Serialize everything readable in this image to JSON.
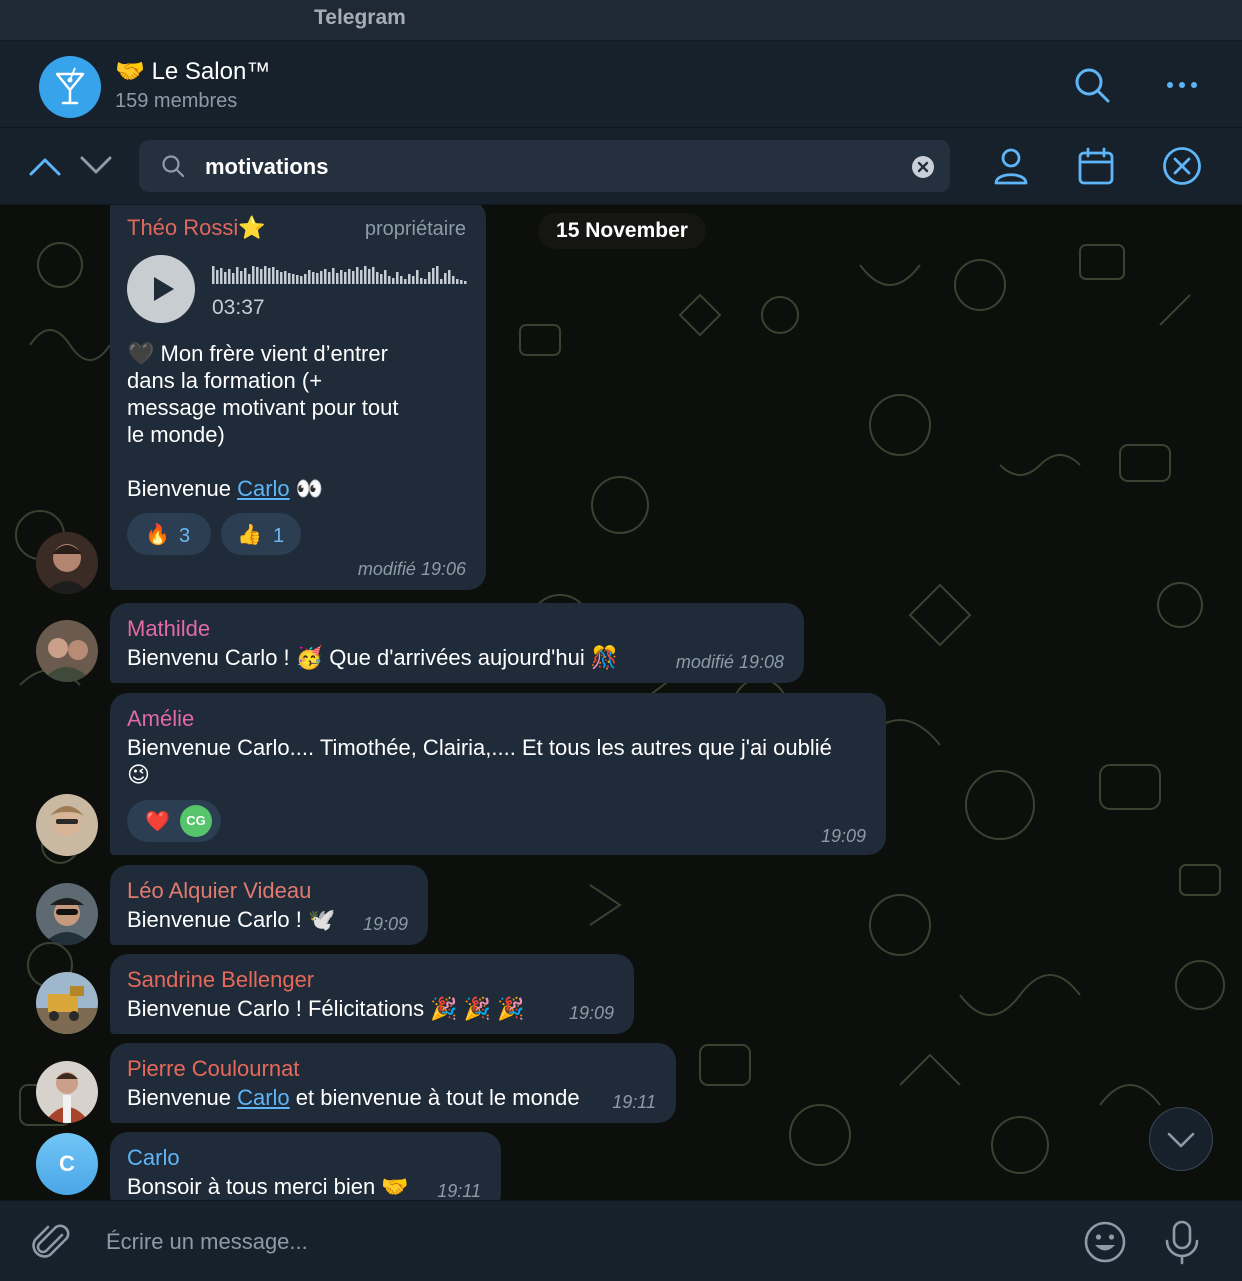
{
  "window": {
    "title": "Telegram"
  },
  "header": {
    "group_emoji": "🤝",
    "group_name": "Le Salon™",
    "members": "159 membres"
  },
  "search": {
    "query": "motivations"
  },
  "date_separator": "15 November",
  "messages": [
    {
      "sender": "Théo Rossi",
      "sender_badge": "⭐",
      "role": "propriétaire",
      "voice_duration": "03:37",
      "text_line1": "🖤 Mon frère vient d’entrer",
      "text_line2": "dans la formation (+",
      "text_line3": "message motivant pour tout",
      "text_line4": "le monde)",
      "text_welcome": "Bienvenue ",
      "mention": "Carlo",
      "text_end": " 👀",
      "reaction1_emoji": "🔥",
      "reaction1_count": "3",
      "reaction2_emoji": "👍",
      "reaction2_count": "1",
      "time": "modifié 19:06"
    },
    {
      "sender": "Mathilde",
      "text": "Bienvenu Carlo ! 🥳 Que d'arrivées aujourd'hui 🎊",
      "time": "modifié 19:08"
    },
    {
      "sender": "Amélie",
      "text_line1": "Bienvenue Carlo.... Timothée, Clairia,.... Et tous les autres que j'ai oublié",
      "text_line2": "😉",
      "reaction_emoji": "❤️",
      "reaction_avatar": "CG",
      "time": "19:09"
    },
    {
      "sender": "Léo Alquier Videau",
      "text": "Bienvenue Carlo ! 🕊️",
      "time": "19:09"
    },
    {
      "sender": "Sandrine Bellenger",
      "text": "Bienvenue Carlo ! Félicitations 🎉 🎉 🎉",
      "time": "19:09"
    },
    {
      "sender": "Pierre Coulournat",
      "text_before": "Bienvenue ",
      "mention": "Carlo",
      "text_after": " et bienvenue à tout le monde",
      "time": "19:11"
    },
    {
      "sender": "Carlo",
      "avatar_letter": "C",
      "text": "Bonsoir à tous merci bien 🤝",
      "time": "19:11"
    }
  ],
  "composer": {
    "placeholder": "Écrire un message..."
  },
  "colors": {
    "accent": "#5eb5f7",
    "bubble": "#1f2b38",
    "panel": "#17212b",
    "theo": "#e0675c",
    "mathilde": "#e36aa5",
    "amelie": "#e06aa5",
    "leo": "#e07a70",
    "sandrine": "#e6695a",
    "pierre": "#e6695a",
    "carlo": "#5eb5f7"
  },
  "icons": [
    "martini-icon",
    "search-icon",
    "more-icon",
    "chevron-up-icon",
    "chevron-down-icon",
    "clear-icon",
    "person-icon",
    "calendar-icon",
    "close-circle-icon",
    "play-icon",
    "attach-icon",
    "emoji-icon",
    "mic-icon",
    "scroll-down-icon"
  ]
}
